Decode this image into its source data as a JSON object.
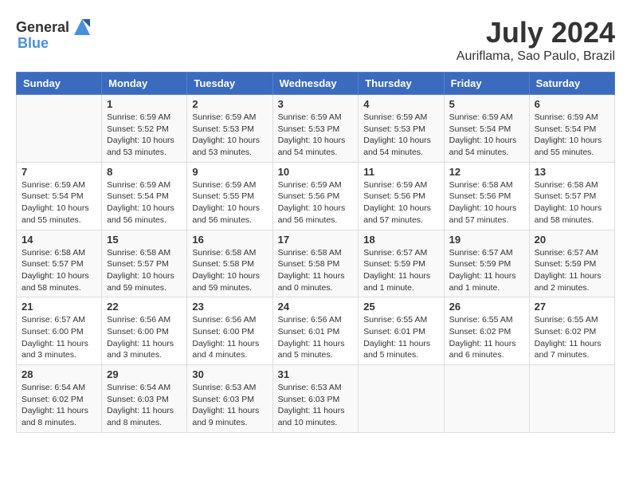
{
  "header": {
    "logo_general": "General",
    "logo_blue": "Blue",
    "month_year": "July 2024",
    "location": "Auriflama, Sao Paulo, Brazil"
  },
  "days_of_week": [
    "Sunday",
    "Monday",
    "Tuesday",
    "Wednesday",
    "Thursday",
    "Friday",
    "Saturday"
  ],
  "weeks": [
    [
      {
        "day": "",
        "info": ""
      },
      {
        "day": "1",
        "info": "Sunrise: 6:59 AM\nSunset: 5:52 PM\nDaylight: 10 hours\nand 53 minutes."
      },
      {
        "day": "2",
        "info": "Sunrise: 6:59 AM\nSunset: 5:53 PM\nDaylight: 10 hours\nand 53 minutes."
      },
      {
        "day": "3",
        "info": "Sunrise: 6:59 AM\nSunset: 5:53 PM\nDaylight: 10 hours\nand 54 minutes."
      },
      {
        "day": "4",
        "info": "Sunrise: 6:59 AM\nSunset: 5:53 PM\nDaylight: 10 hours\nand 54 minutes."
      },
      {
        "day": "5",
        "info": "Sunrise: 6:59 AM\nSunset: 5:54 PM\nDaylight: 10 hours\nand 54 minutes."
      },
      {
        "day": "6",
        "info": "Sunrise: 6:59 AM\nSunset: 5:54 PM\nDaylight: 10 hours\nand 55 minutes."
      }
    ],
    [
      {
        "day": "7",
        "info": ""
      },
      {
        "day": "8",
        "info": "Sunrise: 6:59 AM\nSunset: 5:54 PM\nDaylight: 10 hours\nand 56 minutes."
      },
      {
        "day": "9",
        "info": "Sunrise: 6:59 AM\nSunset: 5:55 PM\nDaylight: 10 hours\nand 56 minutes."
      },
      {
        "day": "10",
        "info": "Sunrise: 6:59 AM\nSunset: 5:56 PM\nDaylight: 10 hours\nand 56 minutes."
      },
      {
        "day": "11",
        "info": "Sunrise: 6:59 AM\nSunset: 5:56 PM\nDaylight: 10 hours\nand 57 minutes."
      },
      {
        "day": "12",
        "info": "Sunrise: 6:58 AM\nSunset: 5:56 PM\nDaylight: 10 hours\nand 57 minutes."
      },
      {
        "day": "13",
        "info": "Sunrise: 6:58 AM\nSunset: 5:57 PM\nDaylight: 10 hours\nand 58 minutes."
      }
    ],
    [
      {
        "day": "14",
        "info": ""
      },
      {
        "day": "15",
        "info": "Sunrise: 6:58 AM\nSunset: 5:57 PM\nDaylight: 10 hours\nand 59 minutes."
      },
      {
        "day": "16",
        "info": "Sunrise: 6:58 AM\nSunset: 5:58 PM\nDaylight: 10 hours\nand 59 minutes."
      },
      {
        "day": "17",
        "info": "Sunrise: 6:58 AM\nSunset: 5:58 PM\nDaylight: 11 hours\nand 0 minutes."
      },
      {
        "day": "18",
        "info": "Sunrise: 6:57 AM\nSunset: 5:59 PM\nDaylight: 11 hours\nand 1 minute."
      },
      {
        "day": "19",
        "info": "Sunrise: 6:57 AM\nSunset: 5:59 PM\nDaylight: 11 hours\nand 1 minute."
      },
      {
        "day": "20",
        "info": "Sunrise: 6:57 AM\nSunset: 5:59 PM\nDaylight: 11 hours\nand 2 minutes."
      }
    ],
    [
      {
        "day": "21",
        "info": ""
      },
      {
        "day": "22",
        "info": "Sunrise: 6:56 AM\nSunset: 6:00 PM\nDaylight: 11 hours\nand 3 minutes."
      },
      {
        "day": "23",
        "info": "Sunrise: 6:56 AM\nSunset: 6:00 PM\nDaylight: 11 hours\nand 4 minutes."
      },
      {
        "day": "24",
        "info": "Sunrise: 6:56 AM\nSunset: 6:01 PM\nDaylight: 11 hours\nand 5 minutes."
      },
      {
        "day": "25",
        "info": "Sunrise: 6:55 AM\nSunset: 6:01 PM\nDaylight: 11 hours\nand 5 minutes."
      },
      {
        "day": "26",
        "info": "Sunrise: 6:55 AM\nSunset: 6:02 PM\nDaylight: 11 hours\nand 6 minutes."
      },
      {
        "day": "27",
        "info": "Sunrise: 6:55 AM\nSunset: 6:02 PM\nDaylight: 11 hours\nand 7 minutes."
      }
    ],
    [
      {
        "day": "28",
        "info": "Sunrise: 6:54 AM\nSunset: 6:02 PM\nDaylight: 11 hours\nand 8 minutes."
      },
      {
        "day": "29",
        "info": "Sunrise: 6:54 AM\nSunset: 6:03 PM\nDaylight: 11 hours\nand 8 minutes."
      },
      {
        "day": "30",
        "info": "Sunrise: 6:53 AM\nSunset: 6:03 PM\nDaylight: 11 hours\nand 9 minutes."
      },
      {
        "day": "31",
        "info": "Sunrise: 6:53 AM\nSunset: 6:03 PM\nDaylight: 11 hours\nand 10 minutes."
      },
      {
        "day": "",
        "info": ""
      },
      {
        "day": "",
        "info": ""
      },
      {
        "day": "",
        "info": ""
      }
    ]
  ],
  "week7_sunday": "Sunrise: 6:59 AM\nSunset: 5:54 PM\nDaylight: 10 hours\nand 55 minutes.",
  "week14_sunday": "Sunrise: 6:58 AM\nSunset: 5:57 PM\nDaylight: 10 hours\nand 58 minutes.",
  "week21_sunday": "Sunrise: 6:57 AM\nSunset: 6:00 PM\nDaylight: 11 hours\nand 3 minutes."
}
